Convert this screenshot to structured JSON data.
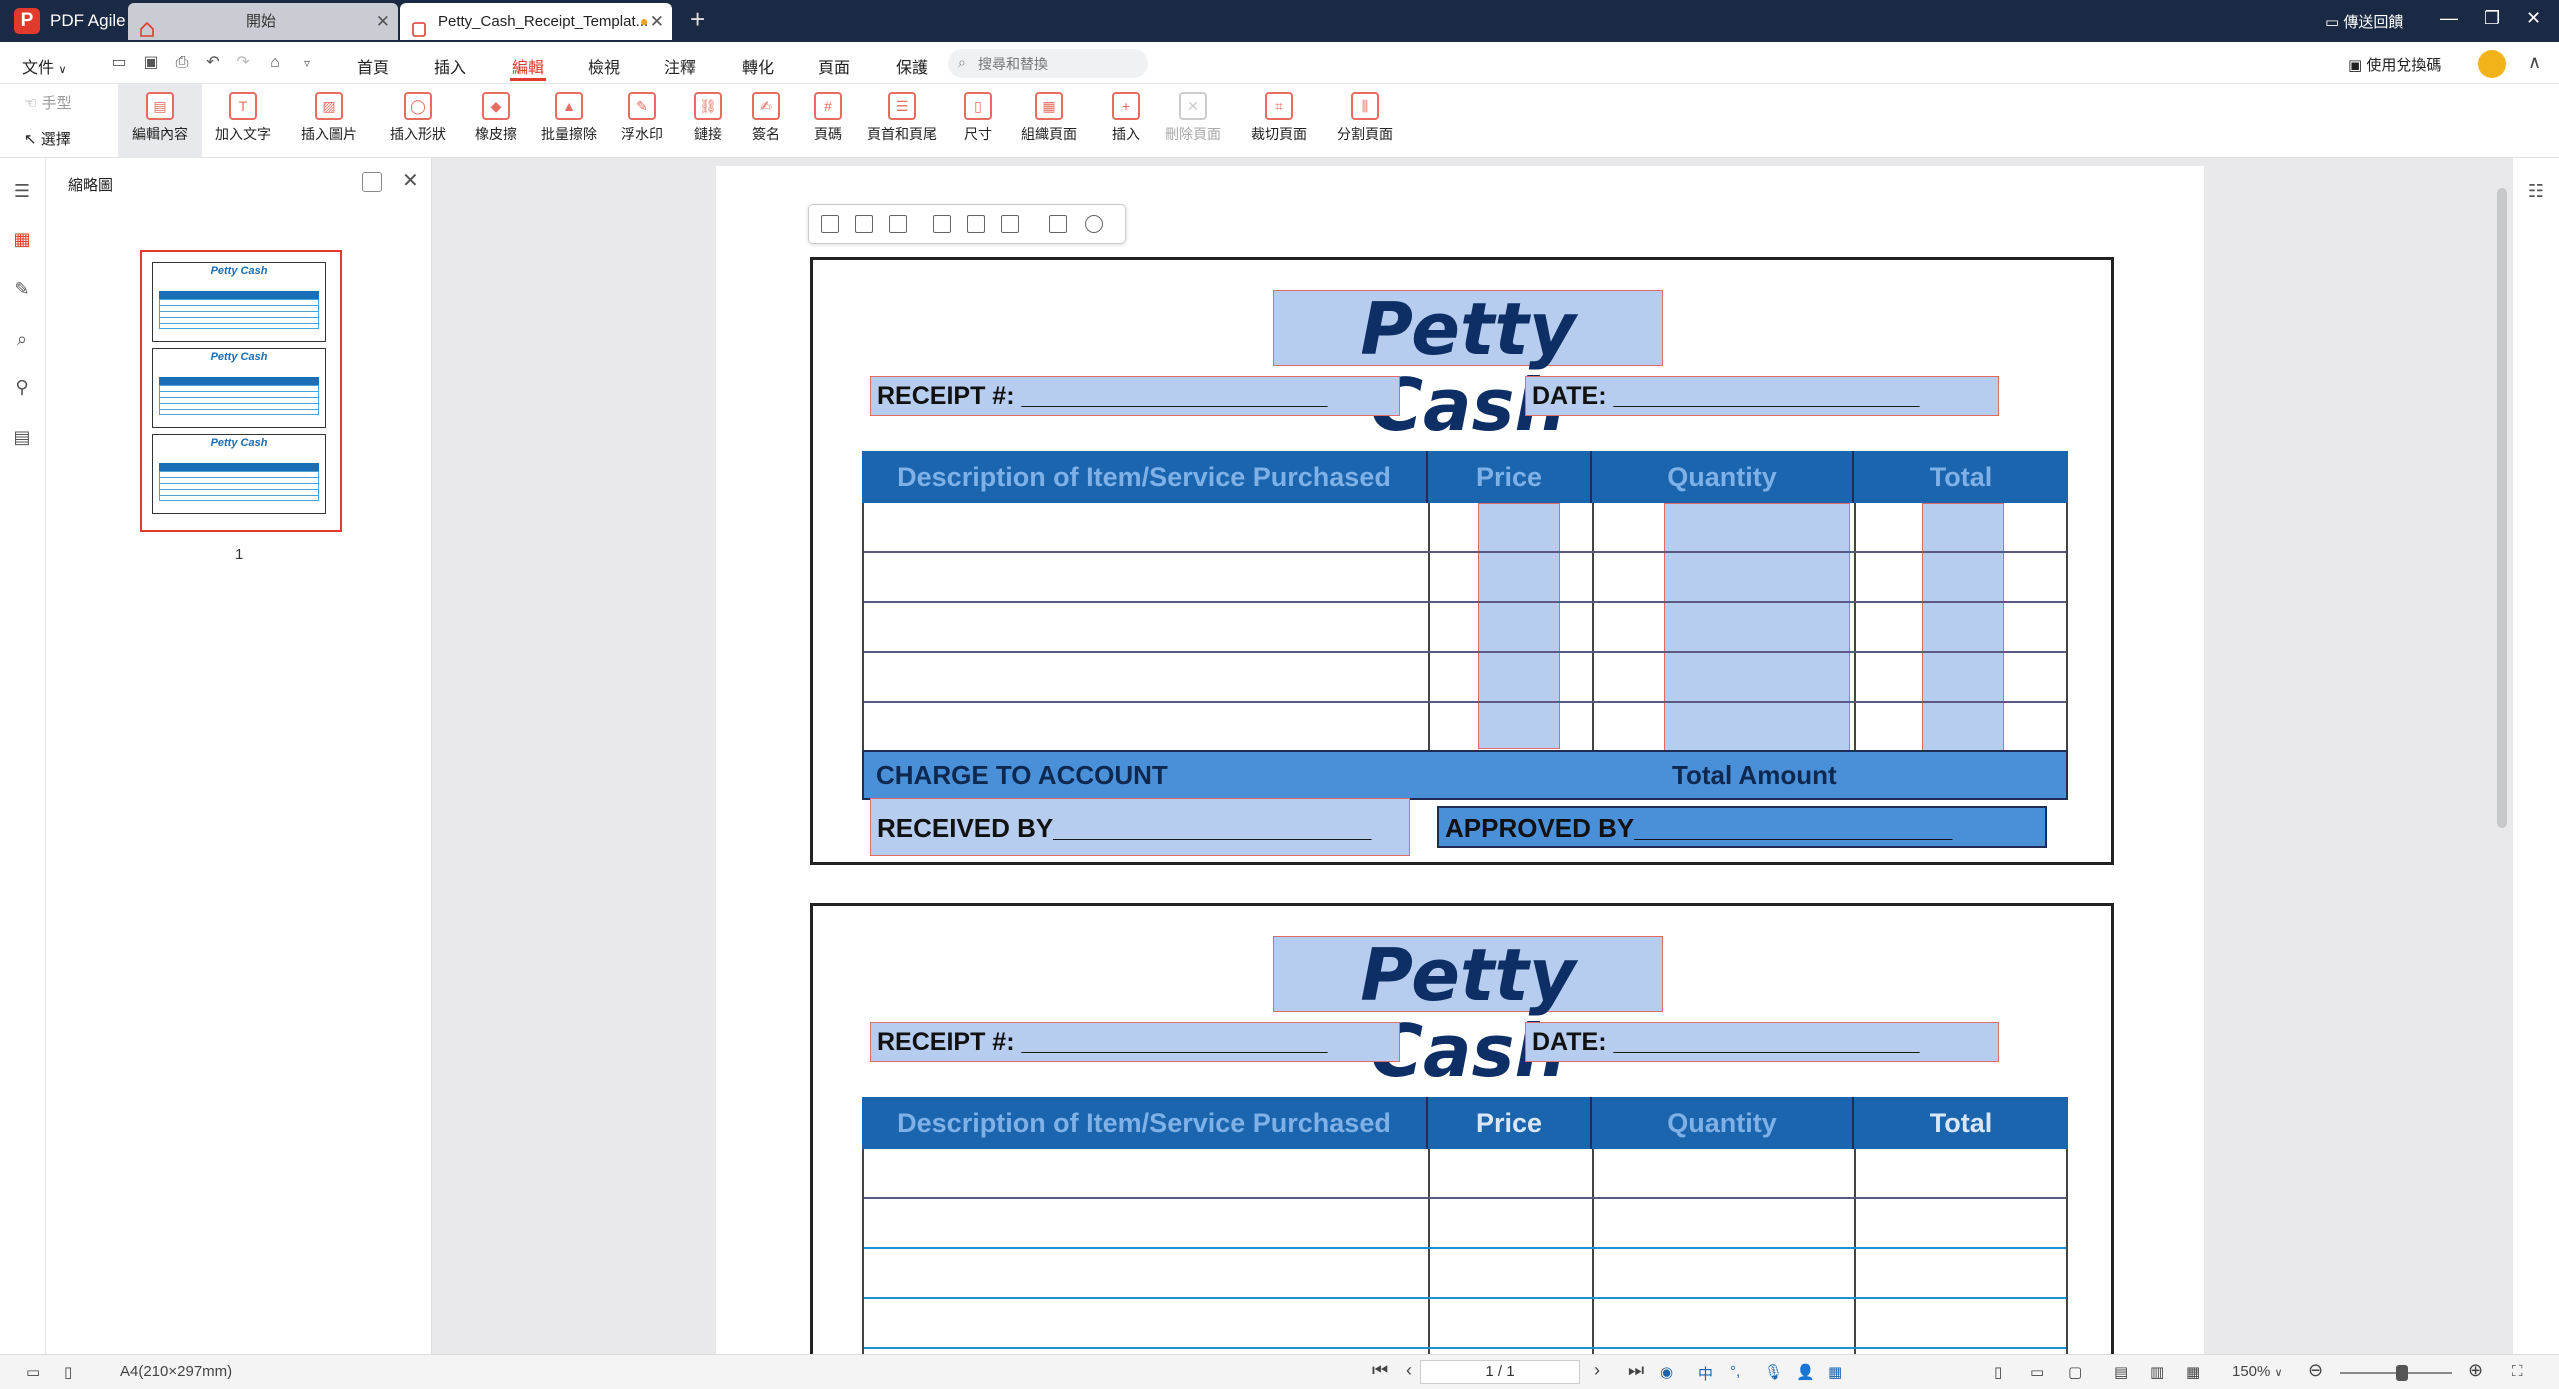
{
  "app": {
    "name": "PDF Agile",
    "logo": "P"
  },
  "tabs": [
    {
      "label": "開始"
    },
    {
      "label": "Petty_Cash_Receipt_Templat..."
    }
  ],
  "window": {
    "send_feedback": "傳送回饋"
  },
  "menu": {
    "file": "文件",
    "items": [
      "首頁",
      "插入",
      "編輯",
      "檢視",
      "注釋",
      "轉化",
      "頁面",
      "保護"
    ],
    "active": "編輯",
    "search_placeholder": "搜尋和替換",
    "redeem": "使用兌換碼"
  },
  "ribbon": {
    "hand": "手型",
    "select": "選擇",
    "tools": [
      "編輯內容",
      "加入文字",
      "插入圖片",
      "插入形狀",
      "橡皮擦",
      "批量擦除",
      "浮水印",
      "鏈接",
      "簽名",
      "頁碼",
      "頁首和頁尾",
      "尺寸",
      "組織頁面",
      "插入",
      "刪除頁面",
      "裁切頁面",
      "分割頁面"
    ]
  },
  "thumbnail_panel": {
    "title": "縮略圖",
    "page_label": "1",
    "mini_title": "Petty Cash"
  },
  "receipt": {
    "title": "Petty Cash",
    "receipt_no": "RECEIPT #: ______________________",
    "date": "DATE: ______________________",
    "columns": [
      "Description of Item/Service Purchased",
      "Price",
      "Quantity",
      "Total"
    ],
    "charge_to": "CHARGE TO ACCOUNT",
    "total_amount": "Total Amount",
    "received_by": "RECEIVED BY______________________",
    "approved_by": "APPROVED BY______________________"
  },
  "status": {
    "page_size": "A4(210×297mm)",
    "page_indicator": "1 / 1",
    "zoom": "150%",
    "zoom_level_percent": 150,
    "ime": "中"
  },
  "colors": {
    "titlebar": "#1b2a44",
    "accent": "#e23b2e",
    "table_header": "#1a65ad",
    "selection_fill": "#b7cdef"
  }
}
